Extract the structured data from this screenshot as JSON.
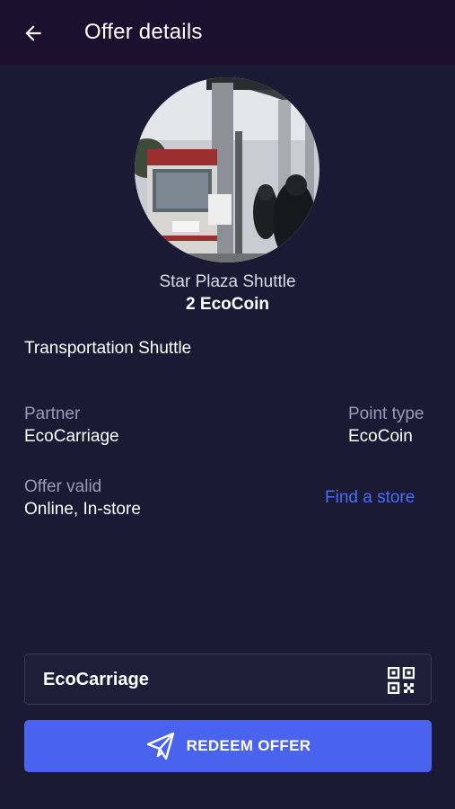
{
  "header": {
    "title": "Offer details",
    "back_icon": "arrow-left-icon"
  },
  "offer": {
    "image_alt": "shuttle-bus-photo",
    "name": "Star Plaza Shuttle",
    "price": "2 EcoCoin",
    "category": "Transportation Shuttle"
  },
  "details": {
    "partner_label": "Partner",
    "partner_value": "EcoCarriage",
    "point_type_label": "Point type",
    "point_type_value": "EcoCoin",
    "valid_label": "Offer valid",
    "valid_value": "Online, In-store",
    "find_store": "Find a store"
  },
  "partner_card": {
    "label": "EcoCarriage",
    "icon": "qr-code-icon"
  },
  "redeem": {
    "label": "REDEEM OFFER",
    "icon": "paper-plane-icon"
  },
  "colors": {
    "background": "#1a1a35",
    "topbar": "#1d0f2e",
    "accent": "#4a63ee",
    "link": "#4a6cf7"
  }
}
